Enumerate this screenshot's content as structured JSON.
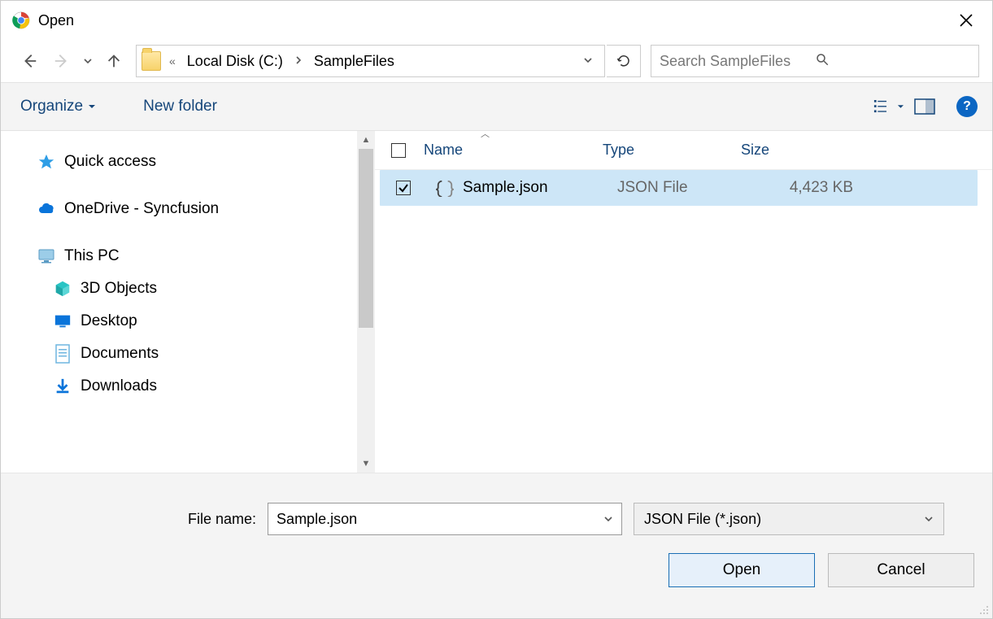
{
  "window": {
    "title": "Open"
  },
  "breadcrumb": {
    "root_marker": "«",
    "drive": "Local Disk (C:)",
    "folder": "SampleFiles"
  },
  "search": {
    "placeholder": "Search SampleFiles"
  },
  "toolbar": {
    "organize": "Organize",
    "new_folder": "New folder"
  },
  "tree": {
    "quick_access": "Quick access",
    "onedrive": "OneDrive - Syncfusion",
    "this_pc": "This PC",
    "objects3d": "3D Objects",
    "desktop": "Desktop",
    "documents": "Documents",
    "downloads": "Downloads"
  },
  "columns": {
    "name": "Name",
    "type": "Type",
    "size": "Size"
  },
  "files": [
    {
      "name": "Sample.json",
      "type": "JSON File",
      "size": "4,423 KB",
      "checked": true,
      "selected": true
    }
  ],
  "footer": {
    "label": "File name:",
    "value": "Sample.json",
    "filter": "JSON File (*.json)",
    "open": "Open",
    "cancel": "Cancel"
  },
  "help_glyph": "?"
}
